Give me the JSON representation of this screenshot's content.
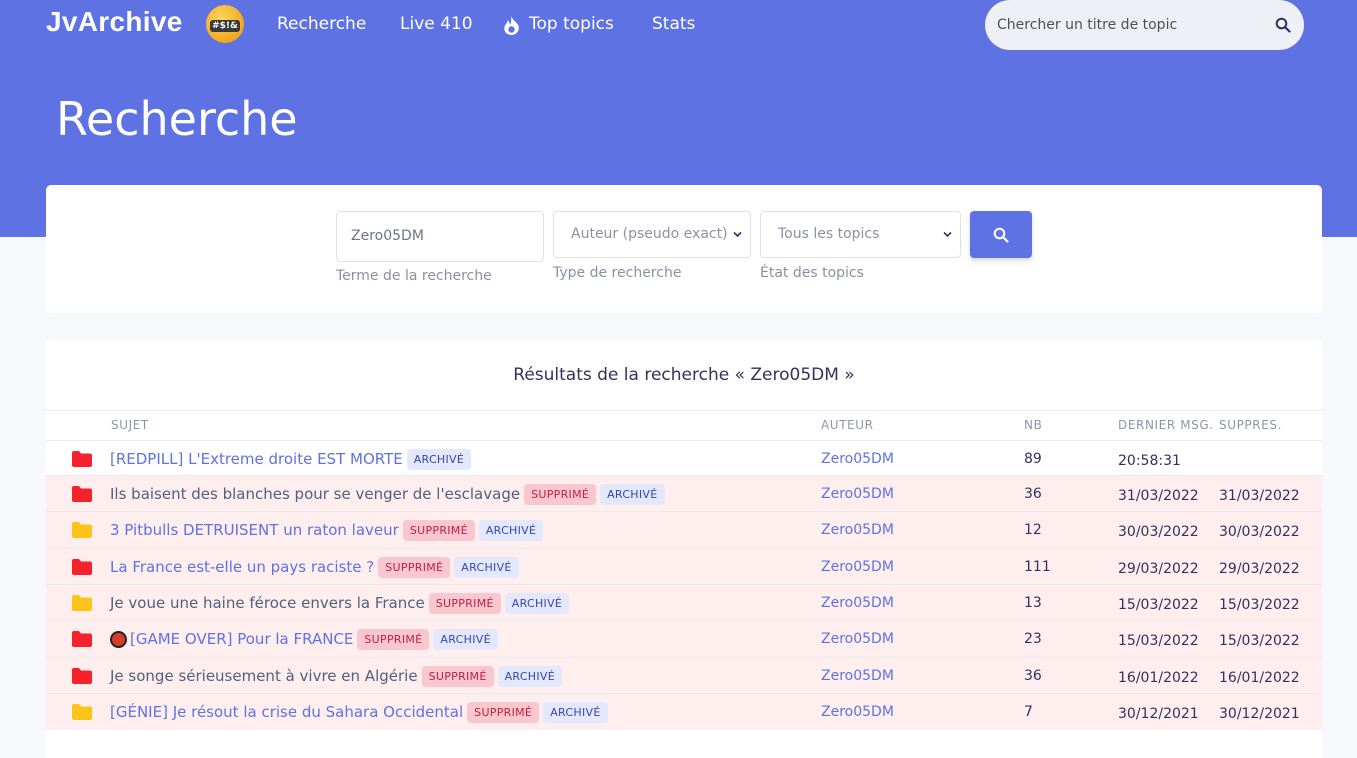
{
  "navbar": {
    "brand": "JvArchive",
    "brand_emoji_text": "#$!&",
    "links": [
      "Recherche",
      "Live 410",
      "Top topics",
      "Stats"
    ],
    "search_placeholder": "Chercher un titre de topic"
  },
  "page_title": "Recherche",
  "form": {
    "term_value": "Zero05DM",
    "term_label": "Terme de la recherche",
    "type_value": "Auteur (pseudo exact)",
    "type_label": "Type de recherche",
    "state_value": "Tous les topics",
    "state_label": "État des topics"
  },
  "results": {
    "title": "Résultats de la recherche « Zero05DM »",
    "headers": [
      "Sujet",
      "Auteur",
      "NB",
      "Dernier msg.",
      "Suppres."
    ],
    "rows": [
      {
        "folder": "red",
        "title": "[REDPILL] L'Extreme droite EST MORTE",
        "deleted": false,
        "badges": [
          "ARCHIVÉ"
        ],
        "author": "Zero05DM",
        "nb": "89",
        "last": "20:58:31",
        "supp": ""
      },
      {
        "folder": "red",
        "title": "Ils baisent des blanches pour se venger de l'esclavage",
        "deleted": true,
        "badges": [
          "SUPPRIMÉ",
          "ARCHIVÉ"
        ],
        "author": "Zero05DM",
        "nb": "36",
        "last": "31/03/2022",
        "supp": "31/03/2022"
      },
      {
        "folder": "yellow",
        "title": "3 Pitbulls DETRUISENT un raton laveur",
        "deleted": true,
        "badges": [
          "SUPPRIMÉ",
          "ARCHIVÉ"
        ],
        "author": "Zero05DM",
        "nb": "12",
        "last": "30/03/2022",
        "supp": "30/03/2022"
      },
      {
        "folder": "red",
        "title": "La France est-elle un pays raciste ?",
        "deleted": true,
        "badges": [
          "SUPPRIMÉ",
          "ARCHIVÉ"
        ],
        "author": "Zero05DM",
        "nb": "111",
        "last": "29/03/2022",
        "supp": "29/03/2022"
      },
      {
        "folder": "yellow",
        "title": "Je voue une haine féroce envers la France",
        "deleted": true,
        "badges": [
          "SUPPRIMÉ",
          "ARCHIVÉ"
        ],
        "author": "Zero05DM",
        "nb": "13",
        "last": "15/03/2022",
        "supp": "15/03/2022"
      },
      {
        "folder": "red",
        "title": "[GAME OVER] Pour la FRANCE",
        "deleted": true,
        "badges": [
          "SUPPRIMÉ",
          "ARCHIVÉ"
        ],
        "author": "Zero05DM",
        "nb": "23",
        "last": "15/03/2022",
        "supp": "15/03/2022",
        "record_icon": true
      },
      {
        "folder": "red",
        "title": "Je songe sérieusement à vivre en Algérie",
        "deleted": true,
        "badges": [
          "SUPPRIMÉ",
          "ARCHIVÉ"
        ],
        "author": "Zero05DM",
        "nb": "36",
        "last": "16/01/2022",
        "supp": "16/01/2022"
      },
      {
        "folder": "yellow",
        "title": "[GÉNIE] Je résout la crise du Sahara Occidental",
        "deleted": true,
        "badges": [
          "SUPPRIMÉ",
          "ARCHIVÉ"
        ],
        "author": "Zero05DM",
        "nb": "7",
        "last": "30/12/2021",
        "supp": "30/12/2021"
      }
    ]
  },
  "colors": {
    "primary": "#5e72e4",
    "folder_red": "#f5222d",
    "folder_yellow": "#fcc419",
    "deleted_row_bg": "#ffeeee"
  },
  "icons": {
    "brand": "grawlix-emoji-icon",
    "top_topics": "fire-icon",
    "search": "search-icon",
    "folder": "folder-icon",
    "record": "record-icon"
  }
}
